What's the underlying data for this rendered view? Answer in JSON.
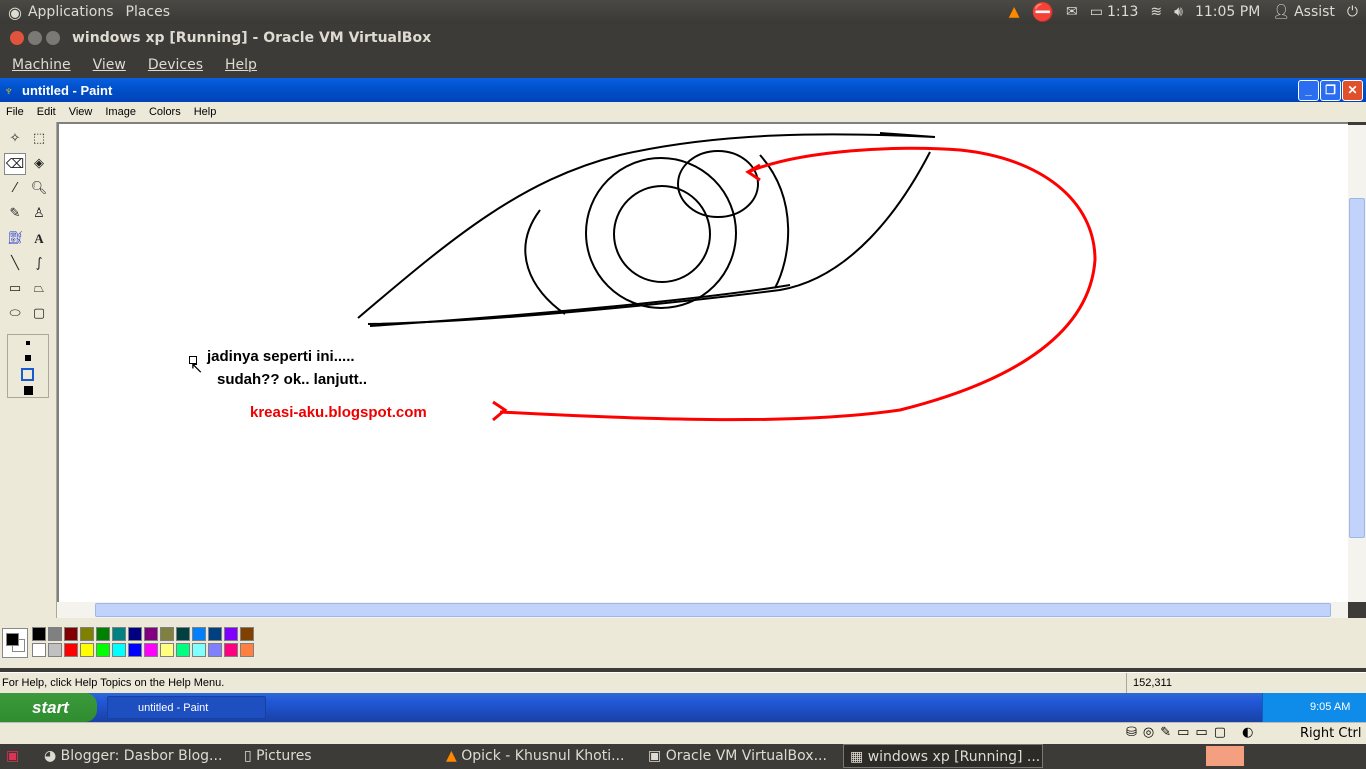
{
  "ubuntu_top": {
    "menus": [
      "Applications",
      "Places"
    ],
    "battery": "1:13",
    "clock": "11:05 PM",
    "user": "Assist"
  },
  "vbox": {
    "title": "windows xp [Running] - Oracle VM VirtualBox",
    "menu": [
      "Machine",
      "View",
      "Devices",
      "Help"
    ],
    "host_key": "Right Ctrl"
  },
  "paint": {
    "title": "untitled - Paint",
    "menu": [
      "File",
      "Edit",
      "View",
      "Image",
      "Colors",
      "Help"
    ],
    "canvas_text": {
      "line1": "jadinya seperti ini.....",
      "line2": "sudah?? ok.. lanjutt..",
      "url": "kreasi-aku.blogspot.com"
    },
    "palette_top": [
      "#000000",
      "#808080",
      "#800000",
      "#808000",
      "#008000",
      "#008080",
      "#000080",
      "#800080",
      "#808040",
      "#004040",
      "#0080ff",
      "#004080",
      "#8000ff",
      "#804000"
    ],
    "palette_bottom": [
      "#ffffff",
      "#c0c0c0",
      "#ff0000",
      "#ffff00",
      "#00ff00",
      "#00ffff",
      "#0000ff",
      "#ff00ff",
      "#ffff80",
      "#00ff80",
      "#80ffff",
      "#8080ff",
      "#ff0080",
      "#ff8040"
    ],
    "status_help": "For Help, click Help Topics on the Help Menu.",
    "coords": "152,311"
  },
  "xp_taskbar": {
    "start": "start",
    "task": "untitled - Paint",
    "clock": "9:05 AM"
  },
  "ubuntu_bottom": {
    "tasks": [
      "Blogger: Dasbor Blog...",
      "Pictures",
      "Opick - Khusnul Khoti...",
      "Oracle VM VirtualBox...",
      "windows xp [Running] ..."
    ]
  }
}
